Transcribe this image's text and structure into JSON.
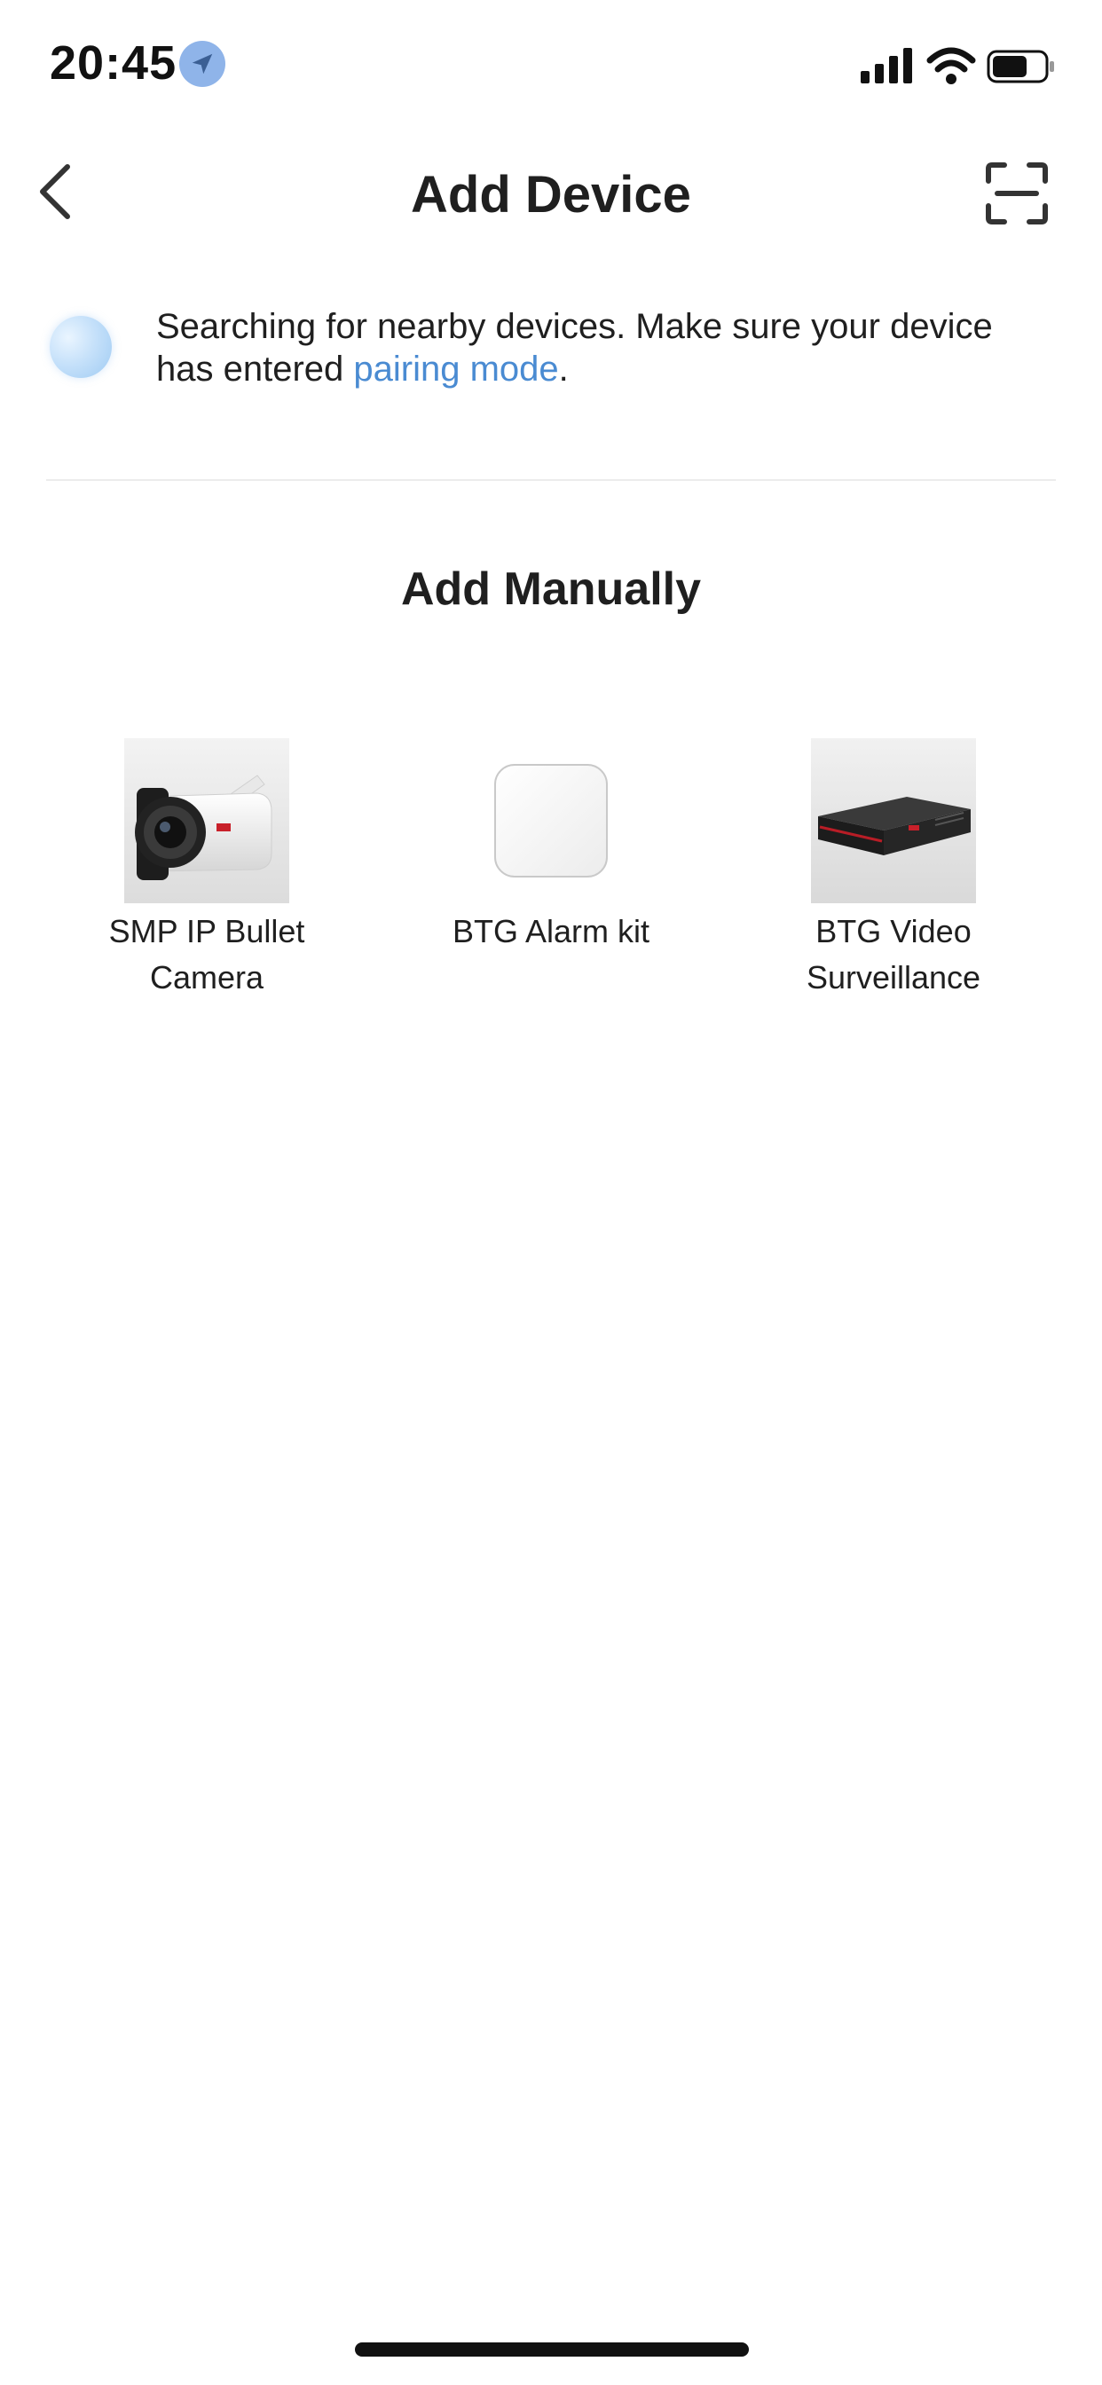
{
  "status_bar": {
    "time": "20:45",
    "location_icon": "location-arrow-icon",
    "signal_icon": "cellular-signal-icon",
    "wifi_icon": "wifi-icon",
    "battery_icon": "battery-icon"
  },
  "nav": {
    "title": "Add Device",
    "back_icon": "chevron-left-icon",
    "scan_icon": "scan-icon"
  },
  "search_banner": {
    "text_before": "Searching for nearby devices. Make sure your device has entered ",
    "link_text": "pairing mode",
    "text_after": "."
  },
  "section": {
    "title": "Add Manually"
  },
  "devices": [
    {
      "label": "SMP IP Bullet Camera",
      "icon": "bullet-camera-image"
    },
    {
      "label": "BTG Alarm kit",
      "icon": "alarm-kit-image"
    },
    {
      "label": "BTG Video Surveillance",
      "icon": "video-recorder-image"
    }
  ],
  "colors": {
    "link": "#4a8bd2",
    "text": "#1f1f1f",
    "divider": "#ececec",
    "location_badge": "#8fb4e9"
  }
}
